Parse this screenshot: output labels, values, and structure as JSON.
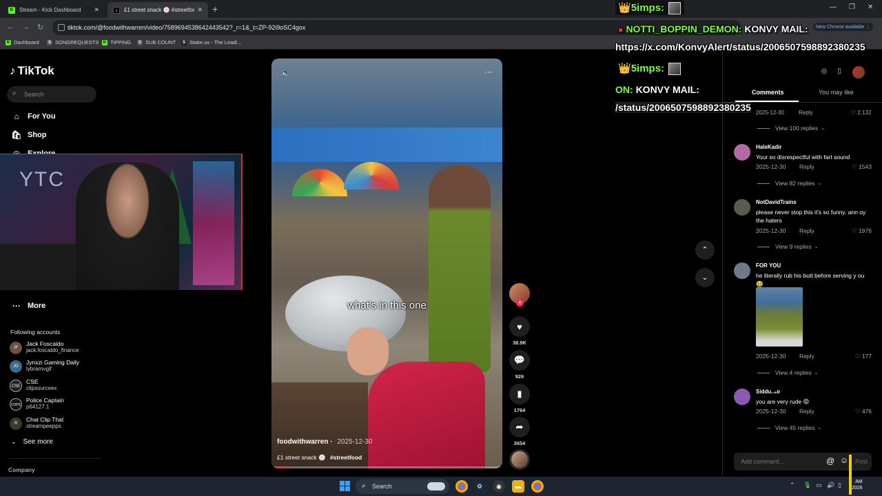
{
  "browser": {
    "tabs": [
      {
        "title": "Stream - Kick Dashboard",
        "icon": "kick-icon"
      },
      {
        "title": "£1 street snack 🍥 #streetfood",
        "icon": "tiktok-icon"
      }
    ],
    "url": "tiktok.com/@foodwithwarren/video/7589694538642443542?_r=1&_t=ZP-92i9oSC4gox",
    "new_chrome_label": "New Chrome available",
    "bookmarks": [
      {
        "label": "Dashboard",
        "icon": "kick-icon"
      },
      {
        "label": "SONGREQUESTS",
        "icon": "streamelements-icon"
      },
      {
        "label": "TIPPING",
        "icon": "kick-icon"
      },
      {
        "label": "SUB COUNT",
        "icon": "streamelements-icon"
      },
      {
        "label": "Stake.us - The Leadi...",
        "icon": "stake-icon"
      }
    ]
  },
  "sidebar": {
    "logo": "TikTok",
    "search_placeholder": "Search",
    "nav": [
      {
        "label": "For You",
        "icon": "home-icon"
      },
      {
        "label": "Shop",
        "icon": "shop-icon"
      },
      {
        "label": "Explore",
        "icon": "explore-icon"
      }
    ],
    "more_label": "More",
    "following_header": "Following accounts",
    "following": [
      {
        "name": "Jack Foscaldo",
        "handle": "jack.foscaldo_finance",
        "initials": "JF"
      },
      {
        "name": "Jynxzi Gaming Daily",
        "handle": "lybrarnvgif",
        "initials": "JG"
      },
      {
        "name": "CSE",
        "handle": "clipsourceex",
        "initials": "CSE"
      },
      {
        "name": "Police Captain",
        "handle": "p64127.1",
        "initials": "COPS"
      },
      {
        "name": "Chat Clip That",
        "handle": "streampeepps",
        "initials": "R"
      }
    ],
    "see_more": "See more",
    "company": "Company"
  },
  "webcam": {
    "overlay_text": "YTC"
  },
  "video": {
    "caption": "what's in this one",
    "author": "foodwithwarren",
    "date": "2025-12-30",
    "description": "£1 street snack",
    "hashtag": "#streetfood",
    "progress": 0.08
  },
  "actions": {
    "likes": "38.9K",
    "comments": "926",
    "saves": "1764",
    "shares": "3654"
  },
  "comments_panel": {
    "tabs": [
      "Comments",
      "You may like"
    ],
    "partial_top": {
      "date": "2025-12-30",
      "reply": "Reply",
      "likes": "2,132"
    },
    "view_replies": [
      "View 100 replies",
      "View 82 replies",
      "View 9 replies",
      "View 4 replies",
      "View 45 replies"
    ],
    "comments": [
      {
        "name": "HaleKadir",
        "text": "Your so disrespectful with fart sound",
        "date": "2025-12-30",
        "reply": "Reply",
        "likes": "1543",
        "avatar_color": "#b46aa8"
      },
      {
        "name": "NotDavidTrains",
        "text": "please never stop this it's so funny. ann oy the haters",
        "date": "2025-12-30",
        "reply": "Reply",
        "likes": "1976",
        "avatar_color": "#5a5a4a"
      },
      {
        "name": "FOR YOU",
        "text": "he literally rub his butt before serving y ou 🤮",
        "date": "2025-12-30",
        "reply": "Reply",
        "likes": "177",
        "avatar_color": "#6c7a8a"
      },
      {
        "name": "Siddu..₈ᴅ",
        "text": "you are very rude 😡",
        "date": "2025-12-30",
        "reply": "Reply",
        "likes": "476",
        "avatar_color": "#8a5ab0"
      }
    ],
    "add_comment_placeholder": "Add comment...",
    "post_label": "Post"
  },
  "stream_overlay": {
    "alert1_user": "5imps:",
    "alert2_user": "NOTTI_BOPPIN_DEMON:",
    "alert2_msg": "KONVY MAIL:",
    "alert2_link": "https://x.com/KonvyAlert/status/2006507598892380235",
    "alert3_user": "5imps:",
    "alert4_user": "ON:",
    "alert4_msg": "KONVY MAIL:",
    "alert4_link": "/status/2006507598892380235"
  },
  "taskbar": {
    "search_label": "Search",
    "clock_time": "AM",
    "clock_year": "2026"
  }
}
